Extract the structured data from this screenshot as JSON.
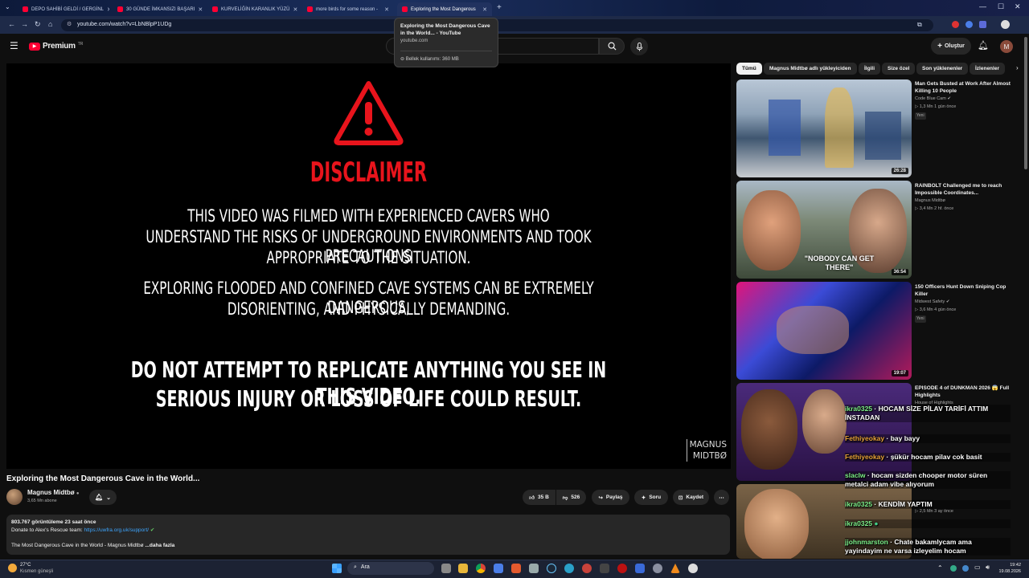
{
  "browser": {
    "tabs": [
      {
        "title": "DEPO SAHİBİ GELDİ / GERGİNL"
      },
      {
        "title": "30 GÜNDE İMKANSIZI BAŞARI"
      },
      {
        "title": "KURVELİĞİN KARANLIK YÜZÜ"
      },
      {
        "title": "more birds for some reason -"
      },
      {
        "title": "Exploring the Most Dangerous"
      }
    ],
    "url": "youtube.com/watch?v=LbNBlpP1UDg",
    "tooltip": {
      "title": "Exploring the Most Dangerous Cave in the World... - YouTube",
      "domain": "youtube.com",
      "memory": "Bellek kullanımı: 360 MB"
    }
  },
  "header": {
    "logo_text": "Premium",
    "logo_sup": "TR",
    "create_label": "Oluştur",
    "avatar_letter": "M"
  },
  "player": {
    "heading": "DISCLAIMER",
    "para1": [
      "THIS VIDEO WAS FILMED WITH EXPERIENCED CAVERS WHO",
      "UNDERSTAND THE RISKS OF UNDERGROUND ENVIRONMENTS AND TOOK PRECAUTIONS",
      "APPROPRIATE TO THE SITUATION."
    ],
    "para2": [
      "EXPLORING FLOODED AND CONFINED CAVE SYSTEMS CAN BE EXTREMELY DANGEROUS,",
      "DISORIENTING, AND PHYSICALLY DEMANDING."
    ],
    "warning": [
      "DO NOT ATTEMPT TO REPLICATE ANYTHING YOU SEE IN THIS VIDEO.",
      "SERIOUS INJURY OR LOSS OF LIFE COULD RESULT."
    ],
    "watermark": [
      "MAGNUS",
      "MIDTBØ"
    ]
  },
  "video": {
    "title": "Exploring the Most Dangerous Cave in the World...",
    "channel": "Magnus Midtbø",
    "subscribers": "3,65 Mn abone",
    "likes": "35 B",
    "dislikes": "526",
    "share_label": "Paylaş",
    "ask_label": "Soru",
    "save_label": "Kaydet"
  },
  "description": {
    "stats": "803.767 görüntüleme  23 saat önce",
    "donate_text": "Donate to Alex's Rescue team:",
    "donate_link": "https://uwfra.org.uk/support/",
    "line3": "The Most Dangerous Cave in the World - Magnus Midtbø",
    "more": "...daha fazla"
  },
  "filters": [
    "Tümü",
    "Magnus Midtbø adlı yükleyiciden",
    "İlgili",
    "Size özel",
    "Son yüklenenler",
    "İzlenenler"
  ],
  "recommendations": [
    {
      "title": "Man Gets Busted at Work After Almost Killing 10 People",
      "channel": "Code Blue Cam",
      "meta": "1,3 Mn  1 gün önce",
      "badge": "Yeni",
      "duration": "26:28"
    },
    {
      "title": "RAINBOLT Challenged me to reach Impossible Coordinates...",
      "channel": "Magnus Midtbø",
      "meta": "3,4 Mn  2 hf. önce",
      "badge": "",
      "duration": "36:54",
      "thumb_text": "\"NOBODY CAN GET THERE\""
    },
    {
      "title": "150 Officers Hunt Down Sniping Cop Killer",
      "channel": "Midwest Safety",
      "meta": "3,6 Mn  4 gün önce",
      "badge": "Yeni",
      "duration": "19:07"
    },
    {
      "title": "EPISODE 4 of DUNKMAN 2026 😱 Full Highlights",
      "channel": "House of Highlights",
      "meta": "",
      "badge": "",
      "duration": ""
    },
    {
      "title": "",
      "channel": "",
      "meta": "2,5 Mn  3 ay önce",
      "badge": "",
      "duration": ""
    }
  ],
  "chat": [
    {
      "user": "ikra0325",
      "text": "HOCAM SİZE PİLAV TARİFİ ATTIM İNSTADAN",
      "color": "green"
    },
    {
      "user": "Fethiyeokay",
      "text": "bay bayy",
      "color": "orange"
    },
    {
      "user": "Fethiyeokay",
      "text": "şükür hocam pilav cok basit",
      "color": "orange"
    },
    {
      "user": "slaclw",
      "text": "hocam sizden chooper motor süren metalci adam vibe alıyorum",
      "color": "green"
    },
    {
      "user": "ikra0325",
      "text": "KENDİM YAPTIM",
      "color": "green"
    },
    {
      "user": "ikra0325",
      "text": "",
      "color": "green"
    },
    {
      "user": "jjohnmarston",
      "text": "Chate bakamlycam ama yayindayim ne varsa izleyelim hocam",
      "color": "green"
    }
  ],
  "taskbar": {
    "weather_temp": "27°C",
    "weather_desc": "Kısmen güneşli",
    "search_placeholder": "Ara",
    "time": "19:42",
    "date": "19.08.2026"
  }
}
